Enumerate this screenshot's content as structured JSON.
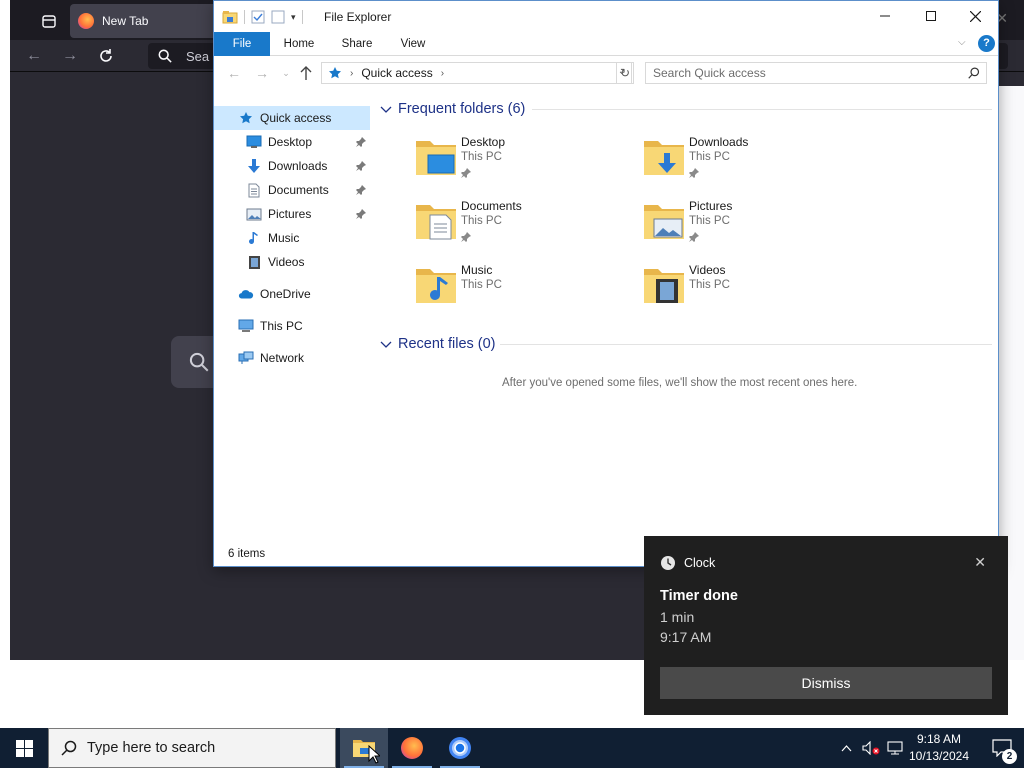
{
  "firefox": {
    "tab_title": "New Tab",
    "url_placeholder": "Sea"
  },
  "explorer": {
    "title": "File Explorer",
    "ribbon_tabs": [
      "File",
      "Home",
      "Share",
      "View"
    ],
    "address": {
      "location": "Quick access"
    },
    "search_placeholder": "Search Quick access",
    "nav": {
      "quick_access": "Quick access",
      "pinned": [
        {
          "label": "Desktop",
          "icon": "desktop-icon",
          "pinned": true
        },
        {
          "label": "Downloads",
          "icon": "downloads-icon",
          "pinned": true
        },
        {
          "label": "Documents",
          "icon": "documents-icon",
          "pinned": true
        },
        {
          "label": "Pictures",
          "icon": "pictures-icon",
          "pinned": true
        },
        {
          "label": "Music",
          "icon": "music-icon",
          "pinned": false
        },
        {
          "label": "Videos",
          "icon": "videos-icon",
          "pinned": false
        }
      ],
      "onedrive": "OneDrive",
      "this_pc": "This PC",
      "network": "Network"
    },
    "frequent_header": "Frequent folders (6)",
    "folders": [
      {
        "name": "Desktop",
        "location": "This PC",
        "pinned": true
      },
      {
        "name": "Downloads",
        "location": "This PC",
        "pinned": true
      },
      {
        "name": "Documents",
        "location": "This PC",
        "pinned": true
      },
      {
        "name": "Pictures",
        "location": "This PC",
        "pinned": true
      },
      {
        "name": "Music",
        "location": "This PC",
        "pinned": false
      },
      {
        "name": "Videos",
        "location": "This PC",
        "pinned": false
      }
    ],
    "recent_header": "Recent files (0)",
    "recent_empty_message": "After you've opened some files, we'll show the most recent ones here.",
    "status": "6 items"
  },
  "toast": {
    "app_name": "Clock",
    "title": "Timer done",
    "line1": "1 min",
    "line2": "9:17 AM",
    "button": "Dismiss"
  },
  "taskbar": {
    "search_placeholder": "Type here to search",
    "time": "9:18 AM",
    "date": "10/13/2024",
    "notification_count": "2"
  },
  "colors": {
    "accent": "#1979ca",
    "group_header": "#1e3287",
    "taskbar": "#101f33",
    "toast_bg": "#1f1f1f",
    "folder_yellow": "#f8d775"
  }
}
